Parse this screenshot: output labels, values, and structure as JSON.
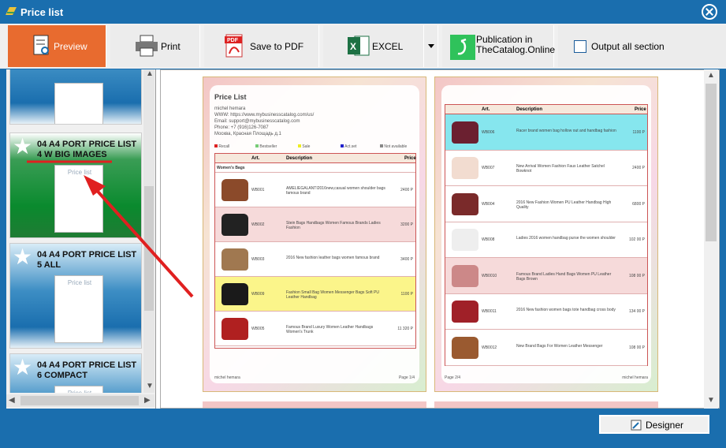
{
  "window": {
    "title": "Price list",
    "close_icon": "close-icon"
  },
  "toolbar": {
    "preview": "Preview",
    "print": "Print",
    "save_pdf": "Save to PDF",
    "excel": "EXCEL",
    "publication_line1": "Publication in",
    "publication_line2": "TheCatalog.Online",
    "output_all": "Output all section"
  },
  "templates": [
    {
      "name": "",
      "selected": false
    },
    {
      "name": "04 A4 PORT PRICE LIST 4 W BIG IMAGES",
      "selected": true
    },
    {
      "name": "04 A4 PORT PRICE LIST 5 ALL",
      "selected": false
    },
    {
      "name": "04 A4 PORT PRICE LIST 6 COMPACT",
      "selected": false
    }
  ],
  "thumb_title": "Price list",
  "page1": {
    "title": "Price List",
    "info": [
      "michel hemara",
      "WWW: https://www.mybusinesscatalog.com/us/",
      "Email: support@mybusinesscatalog.com",
      "Phone: +7 (916)126-7087",
      "Москва, Красная Площадь д.1"
    ],
    "legend": [
      "Recall",
      "Bestseller",
      "Sale",
      "Act.set",
      "Not available"
    ],
    "headers": [
      "Art.",
      "Description",
      "Price"
    ],
    "category": "Women's Bags",
    "rows": [
      {
        "art": "WB001",
        "desc": "AMELIEGALANTI2016new,casual women shoulder bags famous brand",
        "price": "2400 P",
        "hl": "none"
      },
      {
        "art": "WB002",
        "desc": "Stein Bags Handbags Women Famous Brands Ladies Fashion",
        "price": "3200 P",
        "hl": "pink"
      },
      {
        "art": "WB003",
        "desc": "2016 New fashion leather bags women famous brand",
        "price": "3400 P",
        "hl": "none"
      },
      {
        "art": "WB009",
        "desc": "Fashion Small Bag Women Messenger Bags Soft PU Leather Handbag",
        "price": "1100 P",
        "hl": "yellow"
      },
      {
        "art": "WB005",
        "desc": "Famous Brand Luxury Women Leather Handbags Women's Trunk",
        "price": "11 320 P",
        "hl": "none"
      }
    ],
    "footer_left": "michel hemara",
    "footer_right": "Page 1/4"
  },
  "page2": {
    "headers": [
      "Art.",
      "Description",
      "Price"
    ],
    "rows": [
      {
        "art": "WB006",
        "desc": "Racer brand women bag hollow out and handbag fashion",
        "price": "1100 P",
        "hl": "cyan"
      },
      {
        "art": "WB007",
        "desc": "New Arrival Women Fashion Faux Leather Satchel Bowknot",
        "price": "2400 P",
        "hl": "none"
      },
      {
        "art": "WB004",
        "desc": "2016 New Fashion Women PU Leather Handbag High Quality",
        "price": "6800 P",
        "hl": "none"
      },
      {
        "art": "WB008",
        "desc": "Ladies 2016 women handbag purse the women shoulder",
        "price": "102 00 P",
        "hl": "none"
      },
      {
        "art": "WB0010",
        "desc": "Famous Brand Ladies Hand Bags Women PU Leather Bags Brown",
        "price": "108 00 P",
        "hl": "pink"
      },
      {
        "art": "WB0011",
        "desc": "2016 New fashion women bags tote handbag cross body",
        "price": "134 00 P",
        "hl": "none"
      },
      {
        "art": "WB0012",
        "desc": "New Brand Bags For Women Leather Messenger",
        "price": "108 00 P",
        "hl": "none"
      }
    ],
    "footer_left": "Page 2/4",
    "footer_right": "michel hemara"
  },
  "designer": "Designer",
  "colors": {
    "titlebar": "#1a6eae",
    "active_tab": "#e86b2f",
    "selected_card": "#0a8a2e",
    "arrow": "#e02020"
  }
}
